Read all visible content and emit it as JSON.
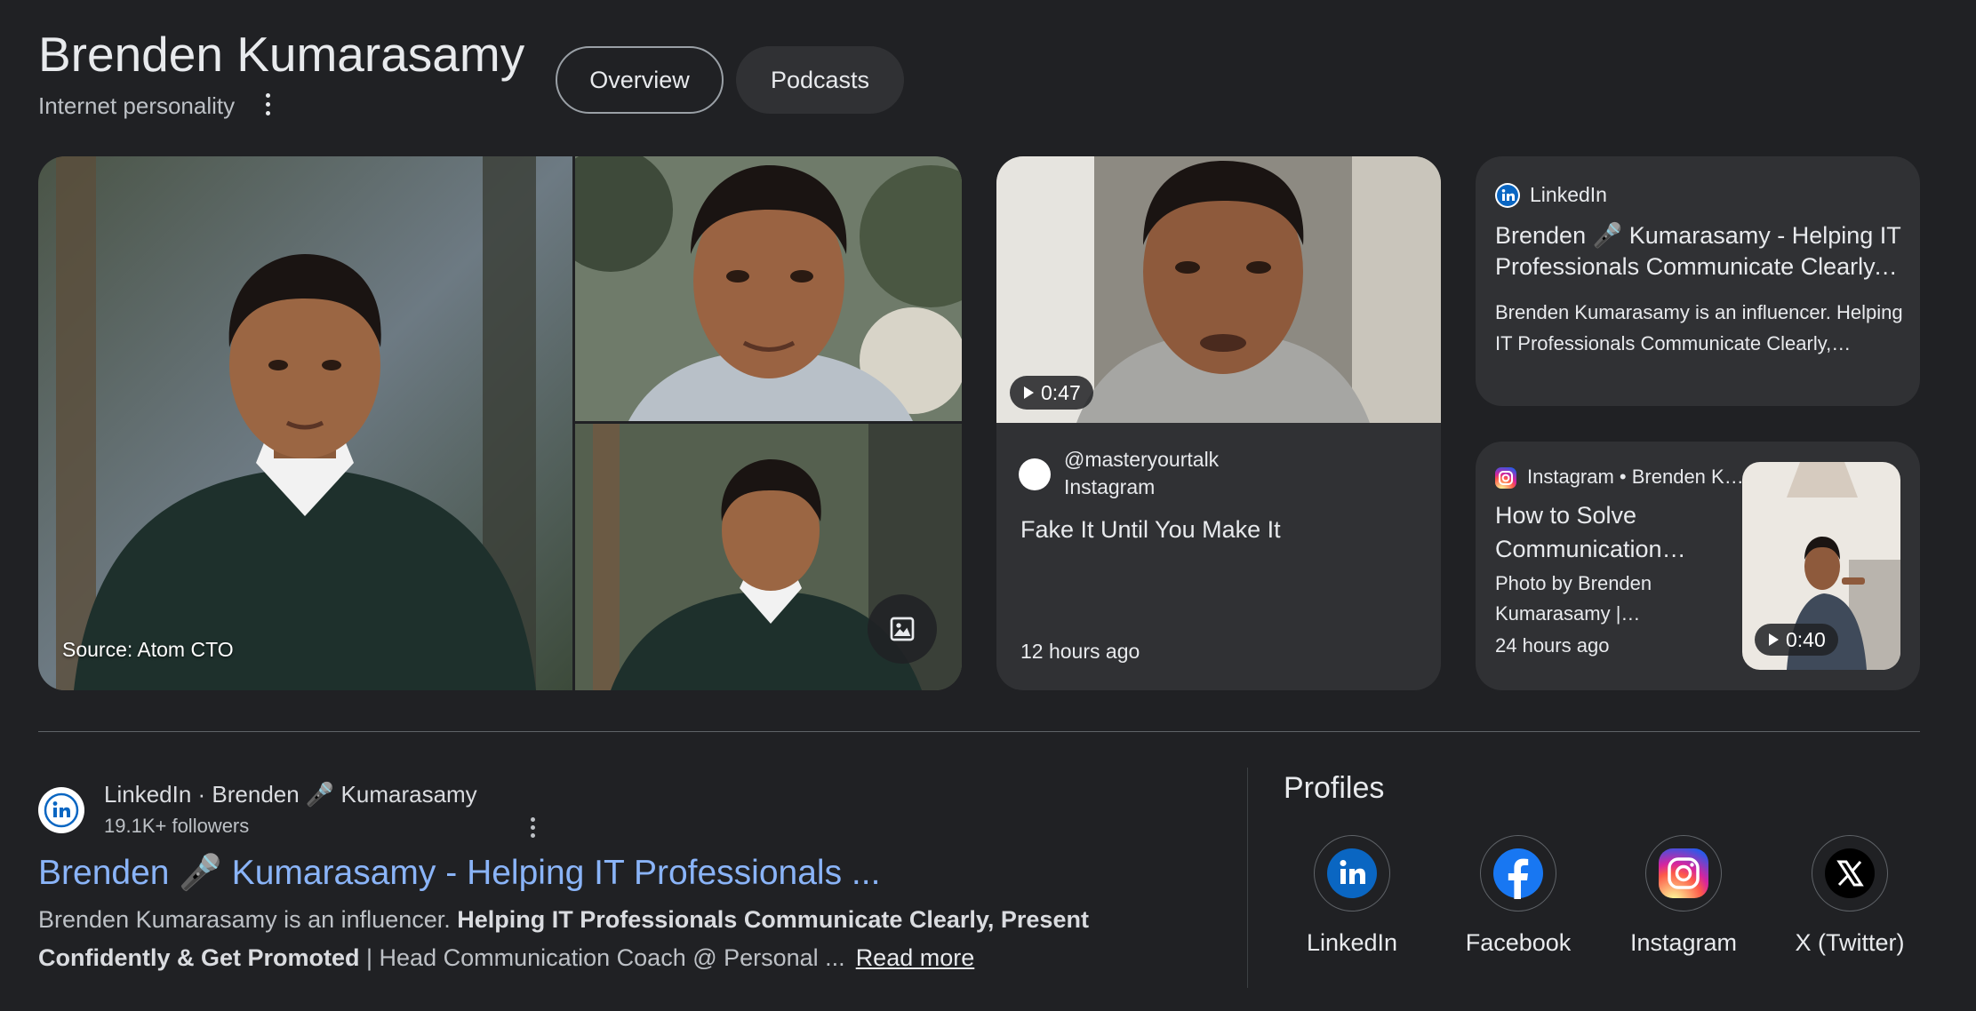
{
  "knowledge_panel": {
    "title": "Brenden Kumarasamy",
    "subtitle": "Internet personality",
    "tabs": [
      {
        "label": "Overview",
        "selected": true
      },
      {
        "label": "Podcasts",
        "selected": false
      }
    ]
  },
  "images": {
    "source_label": "Source: Atom CTO"
  },
  "video_card": {
    "duration": "0:47",
    "handle": "@masteryourtalk",
    "platform": "Instagram",
    "title": "Fake It Until You Make It",
    "time": "12 hours ago"
  },
  "linkedin_card": {
    "source": "LinkedIn",
    "title": "Brenden 🎤 Kumarasamy - Helping IT Professionals Communicate Clearly, Present Confidently & Get Promoted",
    "snippet": "Brenden Kumarasamy is an influencer. Helping IT Professionals Communicate Clearly, Present Confidently & Get Promoted"
  },
  "instagram_card": {
    "source": "Instagram • Brenden Kumarasamy",
    "title": "How to Solve Communication Anxiety",
    "snippet": "Photo by Brenden Kumarasamy | Communication Coach",
    "time": "24 hours ago",
    "duration": "0:40"
  },
  "result": {
    "site": "LinkedIn · Brenden 🎤 Kumarasamy",
    "followers": "19.1K+ followers",
    "title": "Brenden 🎤 Kumarasamy - Helping IT Professionals ...",
    "snippet_start": "Brenden Kumarasamy is an influencer. ",
    "snippet_bold": "Helping IT Professionals Communicate Clearly, Present Confidently & Get Promoted",
    "snippet_end": " | Head Communication Coach @ Personal ...",
    "read_more": "Read more"
  },
  "profiles": {
    "title": "Profiles",
    "items": [
      {
        "label": "LinkedIn",
        "icon": "linkedin-icon"
      },
      {
        "label": "Facebook",
        "icon": "facebook-icon"
      },
      {
        "label": "Instagram",
        "icon": "instagram-icon"
      },
      {
        "label": "X (Twitter)",
        "icon": "x-icon"
      }
    ]
  },
  "colors": {
    "background": "#202124",
    "card": "#303134",
    "link": "#8ab4f8",
    "linkedin": "#0a66c2",
    "facebook": "#1877f2"
  }
}
